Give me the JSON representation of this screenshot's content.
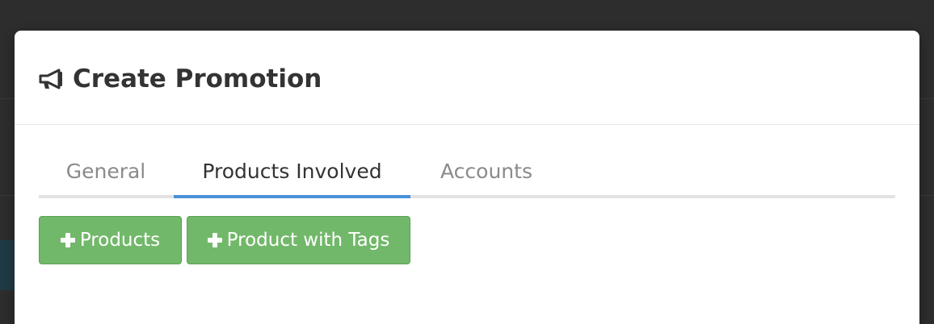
{
  "modal": {
    "title": "Create Promotion",
    "title_icon": "bullhorn-icon"
  },
  "tabs": [
    {
      "label": "General",
      "active": false
    },
    {
      "label": "Products Involved",
      "active": true
    },
    {
      "label": "Accounts",
      "active": false
    }
  ],
  "actions": {
    "add_products_label": "Products",
    "add_product_with_tags_label": "Product with Tags",
    "icon": "plus-icon"
  },
  "colors": {
    "success_button": "#72b86a",
    "active_tab_underline": "#4a90d9",
    "title_text": "#333333",
    "inactive_tab_text": "#8a8a8a",
    "backdrop": "#2d2d2d"
  }
}
